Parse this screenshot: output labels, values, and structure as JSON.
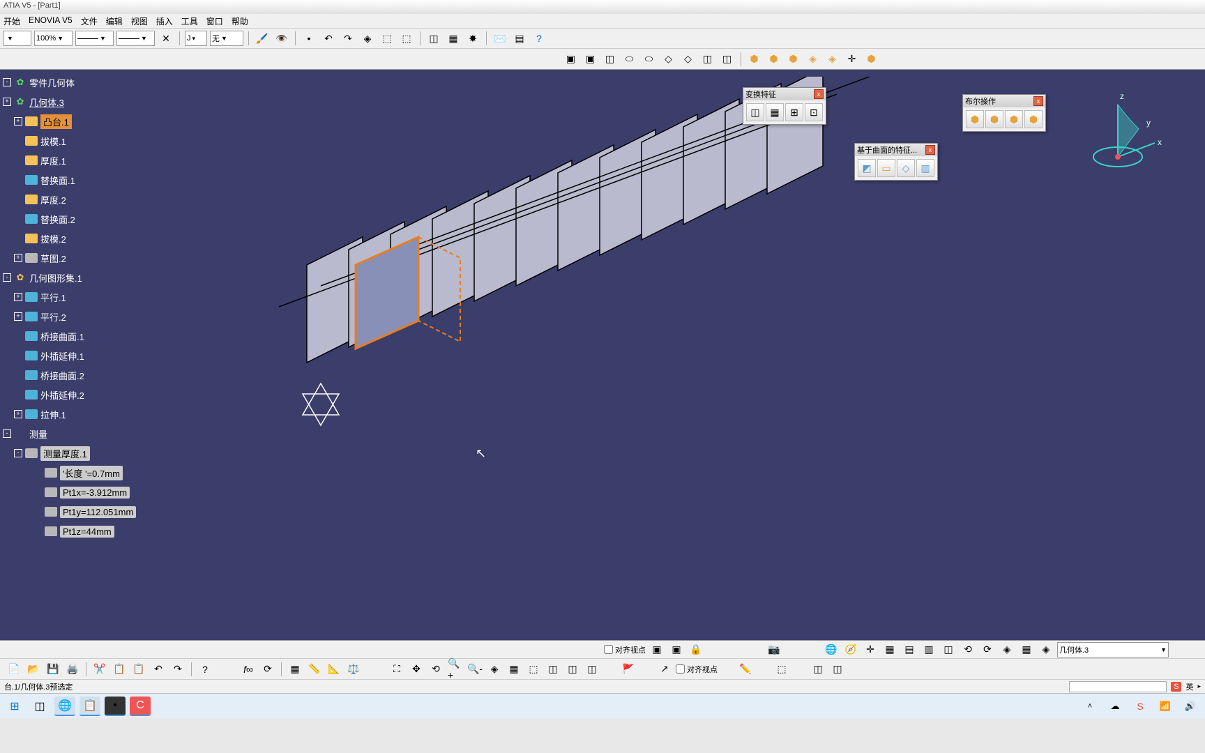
{
  "title": "ATIA V5 - [Part1]",
  "menubar": {
    "items": [
      "开始",
      "ENOVIA V5",
      "文件",
      "编辑",
      "视图",
      "插入",
      "工具",
      "窗口",
      "帮助"
    ]
  },
  "toolbar1": {
    "zoom": "100%",
    "combo_j": "J",
    "combo_none": "无"
  },
  "tree": {
    "items": [
      {
        "icon": "gear",
        "label": "零件几何体",
        "indent": 0,
        "exp": "-"
      },
      {
        "icon": "gear",
        "label": "几何体.3",
        "indent": 0,
        "exp": "+",
        "under": true
      },
      {
        "icon": "yellow",
        "label": "凸台.1",
        "indent": 1,
        "exp": "+",
        "sel": true
      },
      {
        "icon": "yellow",
        "label": "拔模.1",
        "indent": 1,
        "exp": ""
      },
      {
        "icon": "yellow",
        "label": "厚度.1",
        "indent": 1,
        "exp": ""
      },
      {
        "icon": "cyan",
        "label": "替换面.1",
        "indent": 1,
        "exp": ""
      },
      {
        "icon": "yellow",
        "label": "厚度.2",
        "indent": 1,
        "exp": ""
      },
      {
        "icon": "cyan",
        "label": "替换面.2",
        "indent": 1,
        "exp": ""
      },
      {
        "icon": "yellow",
        "label": "拔模.2",
        "indent": 1,
        "exp": ""
      },
      {
        "icon": "grey",
        "label": "草图.2",
        "indent": 1,
        "exp": "+"
      },
      {
        "icon": "gear-y",
        "label": "几何图形集.1",
        "indent": 0,
        "exp": "-"
      },
      {
        "icon": "cyan",
        "label": "平行.1",
        "indent": 1,
        "exp": "+"
      },
      {
        "icon": "cyan",
        "label": "平行.2",
        "indent": 1,
        "exp": "+"
      },
      {
        "icon": "cyan",
        "label": "桥接曲面.1",
        "indent": 1,
        "exp": ""
      },
      {
        "icon": "cyan",
        "label": "外插延伸.1",
        "indent": 1,
        "exp": ""
      },
      {
        "icon": "cyan",
        "label": "桥接曲面.2",
        "indent": 1,
        "exp": ""
      },
      {
        "icon": "cyan",
        "label": "外插延伸.2",
        "indent": 1,
        "exp": ""
      },
      {
        "icon": "cyan",
        "label": "拉伸.1",
        "indent": 1,
        "exp": "+"
      },
      {
        "icon": "",
        "label": "测量",
        "indent": 0,
        "exp": "-"
      },
      {
        "icon": "grey",
        "label": "测量厚度.1",
        "indent": 1,
        "exp": "-",
        "box": true
      },
      {
        "icon": "grey",
        "label": "'长度 '=0.7mm",
        "indent": 2,
        "exp": "",
        "box": true
      },
      {
        "icon": "grey",
        "label": "Pt1x=-3.912mm",
        "indent": 2,
        "exp": "",
        "box": true
      },
      {
        "icon": "grey",
        "label": "Pt1y=112.051mm",
        "indent": 2,
        "exp": "",
        "box": true
      },
      {
        "icon": "grey",
        "label": "Pt1z=44mm",
        "indent": 2,
        "exp": "",
        "box": true
      }
    ]
  },
  "floaters": {
    "transform": {
      "title": "变换特征"
    },
    "bool": {
      "title": "布尔操作"
    },
    "surface": {
      "title": "基于曲面的特征..."
    }
  },
  "axes": {
    "x": "x",
    "y": "y",
    "z": "z"
  },
  "bottom": {
    "align_view": "对齐视点",
    "align_view2": "对齐视点",
    "dropdown": "几何体.3"
  },
  "status": {
    "text": "台.1/几何体.3预选定",
    "lang_badge": "S",
    "lang_text": "英"
  },
  "taskbar": {}
}
